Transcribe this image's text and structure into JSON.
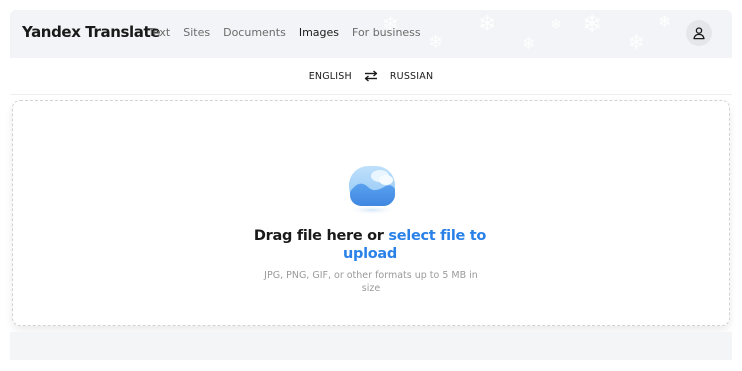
{
  "header": {
    "logo": "Yandex Translate",
    "nav": [
      {
        "label": "Text",
        "active": false
      },
      {
        "label": "Sites",
        "active": false
      },
      {
        "label": "Documents",
        "active": false
      },
      {
        "label": "Images",
        "active": true
      },
      {
        "label": "For business",
        "active": false
      }
    ],
    "account_icon": "user-icon"
  },
  "languages": {
    "source": "ENGLISH",
    "target": "RUSSIAN",
    "swap_icon": "swap-arrows-icon"
  },
  "upload": {
    "icon": "image-icon",
    "headline_prefix": "Drag file here or ",
    "headline_link": "select file to upload",
    "hint": "JPG, PNG, GIF, or other formats up to 5 MB in size"
  },
  "colors": {
    "link": "#2a82e8",
    "header_bg": "#f3f4f7",
    "text": "#1a1a1a",
    "muted": "#9a9a9a"
  }
}
